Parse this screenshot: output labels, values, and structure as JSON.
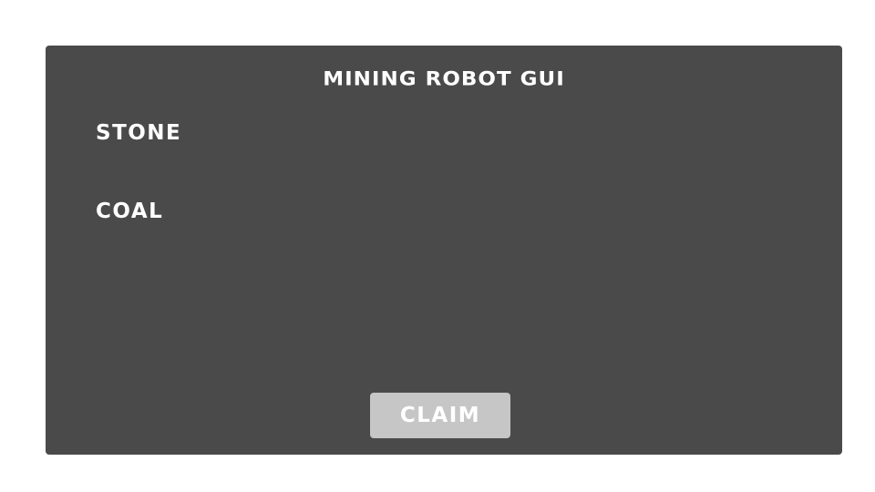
{
  "panel": {
    "title": "MINING ROBOT GUI",
    "resources": [
      {
        "label": "STONE"
      },
      {
        "label": "COAL"
      }
    ],
    "claim_label": "CLAIM"
  },
  "colors": {
    "page_background": "#ffffff",
    "panel_background": "#4a4a4a",
    "text": "#ffffff",
    "button_background": "#c6c6c6"
  }
}
